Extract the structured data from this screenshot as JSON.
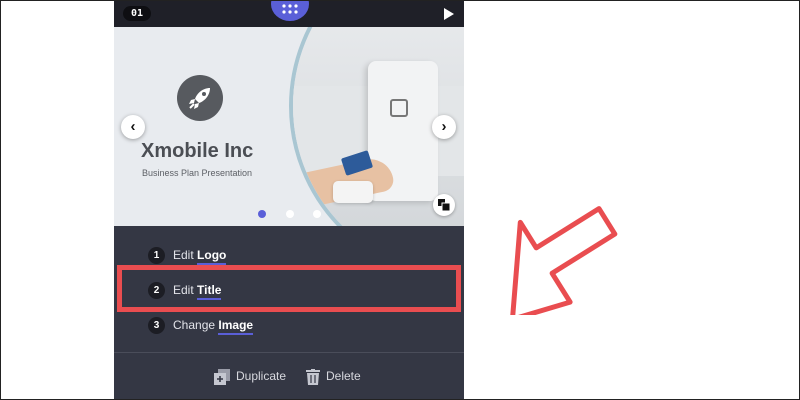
{
  "topbar": {
    "slide_number": "01"
  },
  "slide": {
    "title": "Xmobile Inc",
    "subtitle": "Business Plan Presentation",
    "prev_glyph": "‹",
    "next_glyph": "›",
    "dots": {
      "count": 3,
      "active_index": 0
    }
  },
  "steps": [
    {
      "number": "1",
      "prefix": "Edit",
      "target": "Logo"
    },
    {
      "number": "2",
      "prefix": "Edit",
      "target": "Title"
    },
    {
      "number": "3",
      "prefix": "Change",
      "target": "Image"
    }
  ],
  "footer": {
    "duplicate_label": "Duplicate",
    "delete_label": "Delete"
  },
  "colors": {
    "accent": "#5a5fd8",
    "highlight": "#e94d50",
    "panel": "#343744",
    "topbar": "#1f2028"
  },
  "icons": [
    "grid-icon",
    "play-icon",
    "rocket-icon",
    "chevron-left-icon",
    "chevron-right-icon",
    "layers-icon",
    "duplicate-icon",
    "trash-icon",
    "arrow-pointer-icon"
  ]
}
